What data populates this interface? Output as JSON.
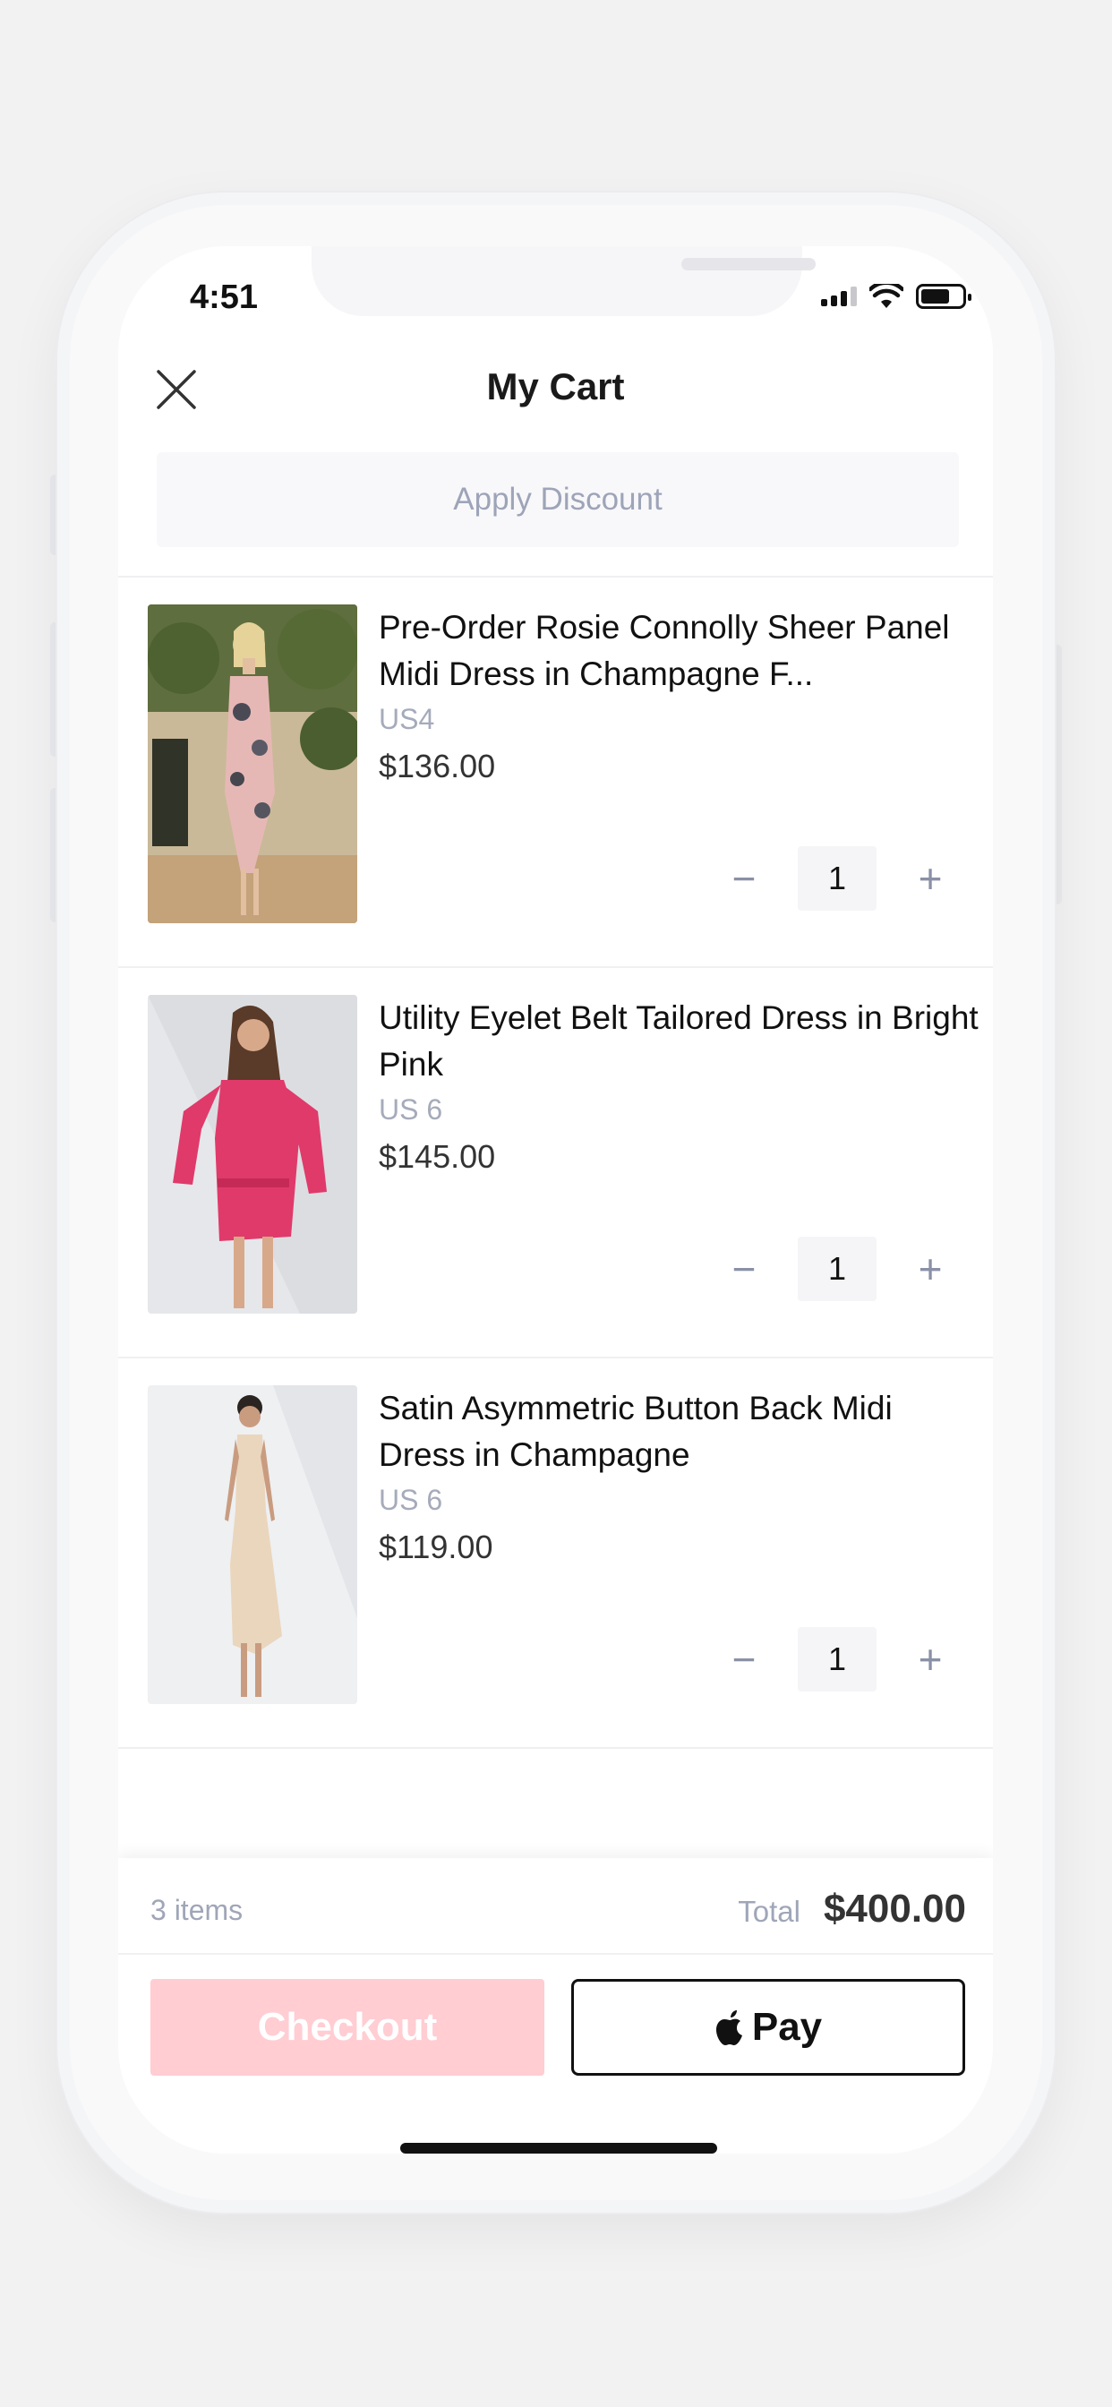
{
  "status_bar": {
    "time": "4:51"
  },
  "header": {
    "title": "My Cart"
  },
  "discount": {
    "label": "Apply Discount"
  },
  "cart": {
    "items": [
      {
        "name": "Pre-Order Rosie Connolly Sheer Panel Midi Dress in Champagne F...",
        "size": "US4",
        "price": "$136.00",
        "quantity": "1",
        "minus": "−",
        "plus": "+"
      },
      {
        "name": "Utility Eyelet Belt Tailored Dress in Bright Pink",
        "size": "US 6",
        "price": "$145.00",
        "quantity": "1",
        "minus": "−",
        "plus": "+"
      },
      {
        "name": "Satin Asymmetric Button Back Midi Dress in Champagne",
        "size": "US 6",
        "price": "$119.00",
        "quantity": "1",
        "minus": "−",
        "plus": "+"
      }
    ]
  },
  "summary": {
    "items_count": "3 items",
    "total_label": "Total",
    "total_value": "$400.00"
  },
  "actions": {
    "checkout_label": "Checkout",
    "applepay_label": "Pay"
  },
  "colors": {
    "checkout_bg": "#ffcdd2",
    "muted_text": "#a0a6b8"
  }
}
